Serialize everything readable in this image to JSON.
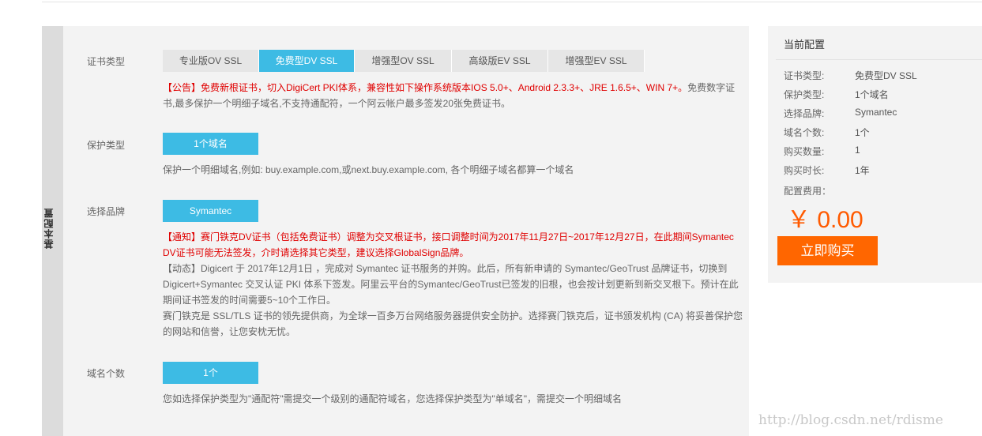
{
  "sidebar": {
    "label": "基本配置"
  },
  "cert_type": {
    "label": "证书类型",
    "tabs": [
      "专业版OV SSL",
      "免费型DV SSL",
      "增强型OV SSL",
      "高级版EV SSL",
      "增强型EV SSL"
    ],
    "active_index": 1,
    "notice_prefix": "【公告】免费新根证书，切入DigiCert PKI体系，兼容性如下操作系统版本IOS 5.0+、Android 2.3.3+、JRE 1.6.5+、WIN 7+。",
    "notice_rest": "免费数字证书,最多保护一个明细子域名,不支持通配符，一个阿云帐户最多签发20张免费证书。"
  },
  "protect_type": {
    "label": "保护类型",
    "option": "1个域名",
    "desc": "保护一个明细域名,例如: buy.example.com,或next.buy.example.com, 各个明细子域名都算一个域名"
  },
  "brand": {
    "label": "选择品牌",
    "option": "Symantec",
    "notice_line1": "【通知】赛门铁克DV证书（包括免费证书）调整为交叉根证书，接口调整时间为2017年11月27日~2017年12月27日，在此期间Symantec",
    "notice_line2": "DV证书可能无法签发，介时请选择其它类型，建议选择GlobalSign品牌。",
    "dynamic_line1": "【动态】Digicert 于 2017年12月1日 ，完成对 Symantec 证书服务的并购。此后，所有新申请的 Symantec/GeoTrust 品牌证书，切换到",
    "dynamic_line2": "Digicert+Symantec 交叉认证 PKI 体系下签发。阿里云平台的Symantec/GeoTrust已签发的旧根，也会按计划更新到新交叉根下。预计在此",
    "dynamic_line3": "期间证书签发的时间需要5~10个工作日。",
    "intro_line1": "赛门铁克是 SSL/TLS 证书的领先提供商，为全球一百多万台网络服务器提供安全防护。选择赛门铁克后，证书颁发机构 (CA) 将妥善保护您",
    "intro_line2": "的网站和信誉，让您安枕无忧。"
  },
  "domain_count": {
    "label": "域名个数",
    "option": "1个",
    "desc": "您如选择保护类型为\"通配符\"需提交一个级别的通配符域名，您选择保护类型为\"单域名\"，需提交一个明细域名"
  },
  "config": {
    "title": "当前配置",
    "rows": [
      {
        "label": "证书类型:",
        "value": "免费型DV SSL"
      },
      {
        "label": "保护类型:",
        "value": "1个域名"
      },
      {
        "label": "选择品牌:",
        "value": "Symantec"
      },
      {
        "label": "域名个数:",
        "value": "1个"
      },
      {
        "label": "购买数量:",
        "value": "1"
      },
      {
        "label": "购买时长:",
        "value": "1年"
      }
    ],
    "fee_label": "配置费用：",
    "price": "￥ 0.00",
    "buy_label": "立即购买"
  },
  "watermark": "http://blog.csdn.net/rdisme",
  "colors": {
    "accent": "#3dbbe4",
    "buy": "#ff6600",
    "price": "#ff5a00",
    "notice": "#e00000"
  }
}
